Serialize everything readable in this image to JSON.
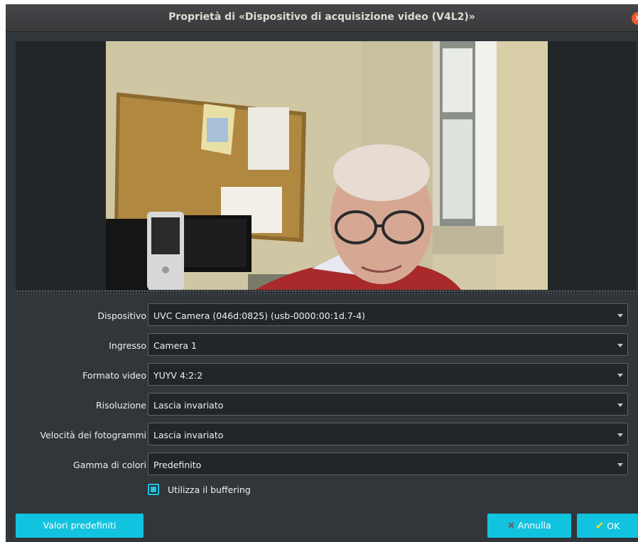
{
  "window": {
    "title": "Proprietà di «Dispositivo di acquisizione video (V4L2)»"
  },
  "form": {
    "rows": [
      {
        "label": "Dispositivo",
        "value": "UVC Camera (046d:0825) (usb-0000:00:1d.7-4)"
      },
      {
        "label": "Ingresso",
        "value": "Camera 1"
      },
      {
        "label": "Formato video",
        "value": "YUYV 4:2:2"
      },
      {
        "label": "Risoluzione",
        "value": "Lascia invariato"
      },
      {
        "label": "Velocità dei fotogrammi",
        "value": "Lascia invariato"
      },
      {
        "label": "Gamma di colori",
        "value": "Predefinito"
      }
    ],
    "buffering": {
      "label": "Utilizza il buffering",
      "checked": true
    }
  },
  "buttons": {
    "defaults": "Valori predefiniti",
    "cancel": "Annulla",
    "ok": "OK"
  },
  "colors": {
    "accent": "#12c3e0",
    "background": "#31363b",
    "field": "#232629"
  },
  "icons": {
    "close": "close-icon",
    "cancel": "x-icon",
    "ok": "check-icon",
    "combo": "chevron-down-icon"
  }
}
